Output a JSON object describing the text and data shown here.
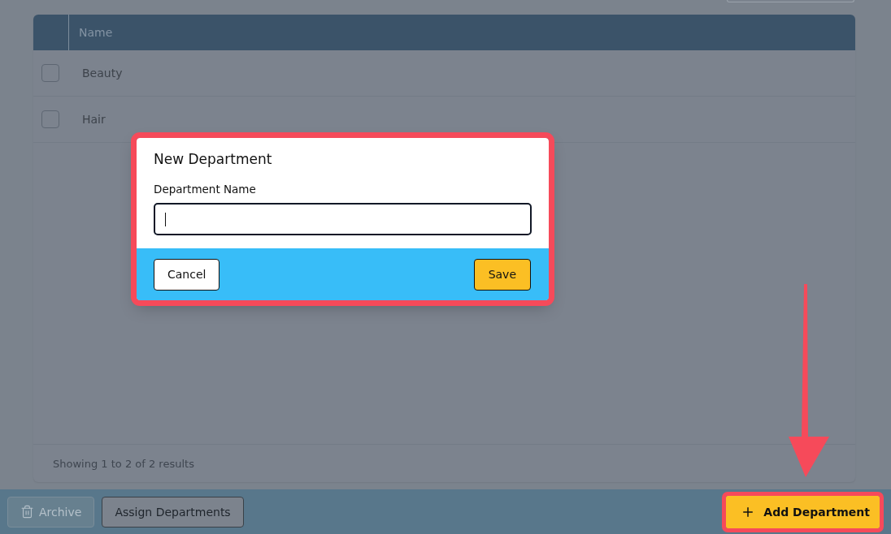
{
  "table": {
    "columns": [
      "Name"
    ],
    "rows": [
      {
        "name": "Beauty",
        "checked": false
      },
      {
        "name": "Hair",
        "checked": false
      }
    ],
    "footer": "Showing 1 to 2 of 2 results"
  },
  "action_bar": {
    "buttons": [
      {
        "label": "Archive",
        "kind": "archive",
        "disabled": true
      },
      {
        "label": "Assign Departments",
        "kind": "plain",
        "disabled": false
      }
    ],
    "add_button": {
      "label": "Add Department",
      "highlighted": true
    }
  },
  "dialog": {
    "title": "New Department",
    "highlighted": true,
    "field_label": "Department Name",
    "focused": true,
    "cancel": "Cancel",
    "save": "Save"
  }
}
